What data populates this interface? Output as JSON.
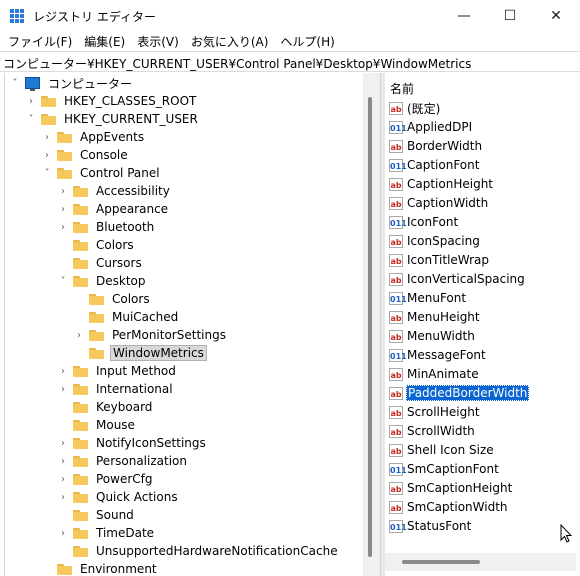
{
  "window": {
    "title": "レジストリ エディター",
    "minimize_glyph": "—",
    "maximize_glyph": "☐",
    "close_glyph": "✕"
  },
  "menu": [
    "ファイル(F)",
    "編集(E)",
    "表示(V)",
    "お気に入り(A)",
    "ヘルプ(H)"
  ],
  "address": "コンピューター¥HKEY_CURRENT_USER¥Control Panel¥Desktop¥WindowMetrics",
  "tree": [
    {
      "label": "コンピューター",
      "level": 0,
      "chev": "v",
      "icon": "pc"
    },
    {
      "label": "HKEY_CLASSES_ROOT",
      "level": 1,
      "chev": ">"
    },
    {
      "label": "HKEY_CURRENT_USER",
      "level": 1,
      "chev": "v"
    },
    {
      "label": "AppEvents",
      "level": 2,
      "chev": ">"
    },
    {
      "label": "Console",
      "level": 2,
      "chev": ">"
    },
    {
      "label": "Control Panel",
      "level": 2,
      "chev": "v"
    },
    {
      "label": "Accessibility",
      "level": 3,
      "chev": ">"
    },
    {
      "label": "Appearance",
      "level": 3,
      "chev": ">"
    },
    {
      "label": "Bluetooth",
      "level": 3,
      "chev": ">"
    },
    {
      "label": "Colors",
      "level": 3,
      "chev": ""
    },
    {
      "label": "Cursors",
      "level": 3,
      "chev": ""
    },
    {
      "label": "Desktop",
      "level": 3,
      "chev": "v"
    },
    {
      "label": "Colors",
      "level": 4,
      "chev": ""
    },
    {
      "label": "MuiCached",
      "level": 4,
      "chev": ""
    },
    {
      "label": "PerMonitorSettings",
      "level": 4,
      "chev": ">"
    },
    {
      "label": "WindowMetrics",
      "level": 4,
      "chev": "",
      "selected": true
    },
    {
      "label": "Input Method",
      "level": 3,
      "chev": ">"
    },
    {
      "label": "International",
      "level": 3,
      "chev": ">"
    },
    {
      "label": "Keyboard",
      "level": 3,
      "chev": ""
    },
    {
      "label": "Mouse",
      "level": 3,
      "chev": ""
    },
    {
      "label": "NotifyIconSettings",
      "level": 3,
      "chev": ">"
    },
    {
      "label": "Personalization",
      "level": 3,
      "chev": ">"
    },
    {
      "label": "PowerCfg",
      "level": 3,
      "chev": ">"
    },
    {
      "label": "Quick Actions",
      "level": 3,
      "chev": ">"
    },
    {
      "label": "Sound",
      "level": 3,
      "chev": ""
    },
    {
      "label": "TimeDate",
      "level": 3,
      "chev": ">"
    },
    {
      "label": "UnsupportedHardwareNotificationCache",
      "level": 3,
      "chev": ""
    },
    {
      "label": "Environment",
      "level": 2,
      "chev": ""
    }
  ],
  "list": {
    "header": "名前",
    "items": [
      {
        "label": "(既定)",
        "type": "str"
      },
      {
        "label": "AppliedDPI",
        "type": "bin"
      },
      {
        "label": "BorderWidth",
        "type": "str"
      },
      {
        "label": "CaptionFont",
        "type": "bin"
      },
      {
        "label": "CaptionHeight",
        "type": "str"
      },
      {
        "label": "CaptionWidth",
        "type": "str"
      },
      {
        "label": "IconFont",
        "type": "bin"
      },
      {
        "label": "IconSpacing",
        "type": "str"
      },
      {
        "label": "IconTitleWrap",
        "type": "str"
      },
      {
        "label": "IconVerticalSpacing",
        "type": "str"
      },
      {
        "label": "MenuFont",
        "type": "bin"
      },
      {
        "label": "MenuHeight",
        "type": "str"
      },
      {
        "label": "MenuWidth",
        "type": "str"
      },
      {
        "label": "MessageFont",
        "type": "bin"
      },
      {
        "label": "MinAnimate",
        "type": "str"
      },
      {
        "label": "PaddedBorderWidth",
        "type": "str",
        "selected": true
      },
      {
        "label": "ScrollHeight",
        "type": "str"
      },
      {
        "label": "ScrollWidth",
        "type": "str"
      },
      {
        "label": "Shell Icon Size",
        "type": "str"
      },
      {
        "label": "SmCaptionFont",
        "type": "bin"
      },
      {
        "label": "SmCaptionHeight",
        "type": "str"
      },
      {
        "label": "SmCaptionWidth",
        "type": "str"
      },
      {
        "label": "StatusFont",
        "type": "bin"
      }
    ]
  },
  "icon_glyphs": {
    "str": "ab",
    "bin": "011"
  },
  "colors": {
    "selection": "#0a64d1",
    "folder": "#f5c95b",
    "tree_selection": "#d9d9d9"
  }
}
